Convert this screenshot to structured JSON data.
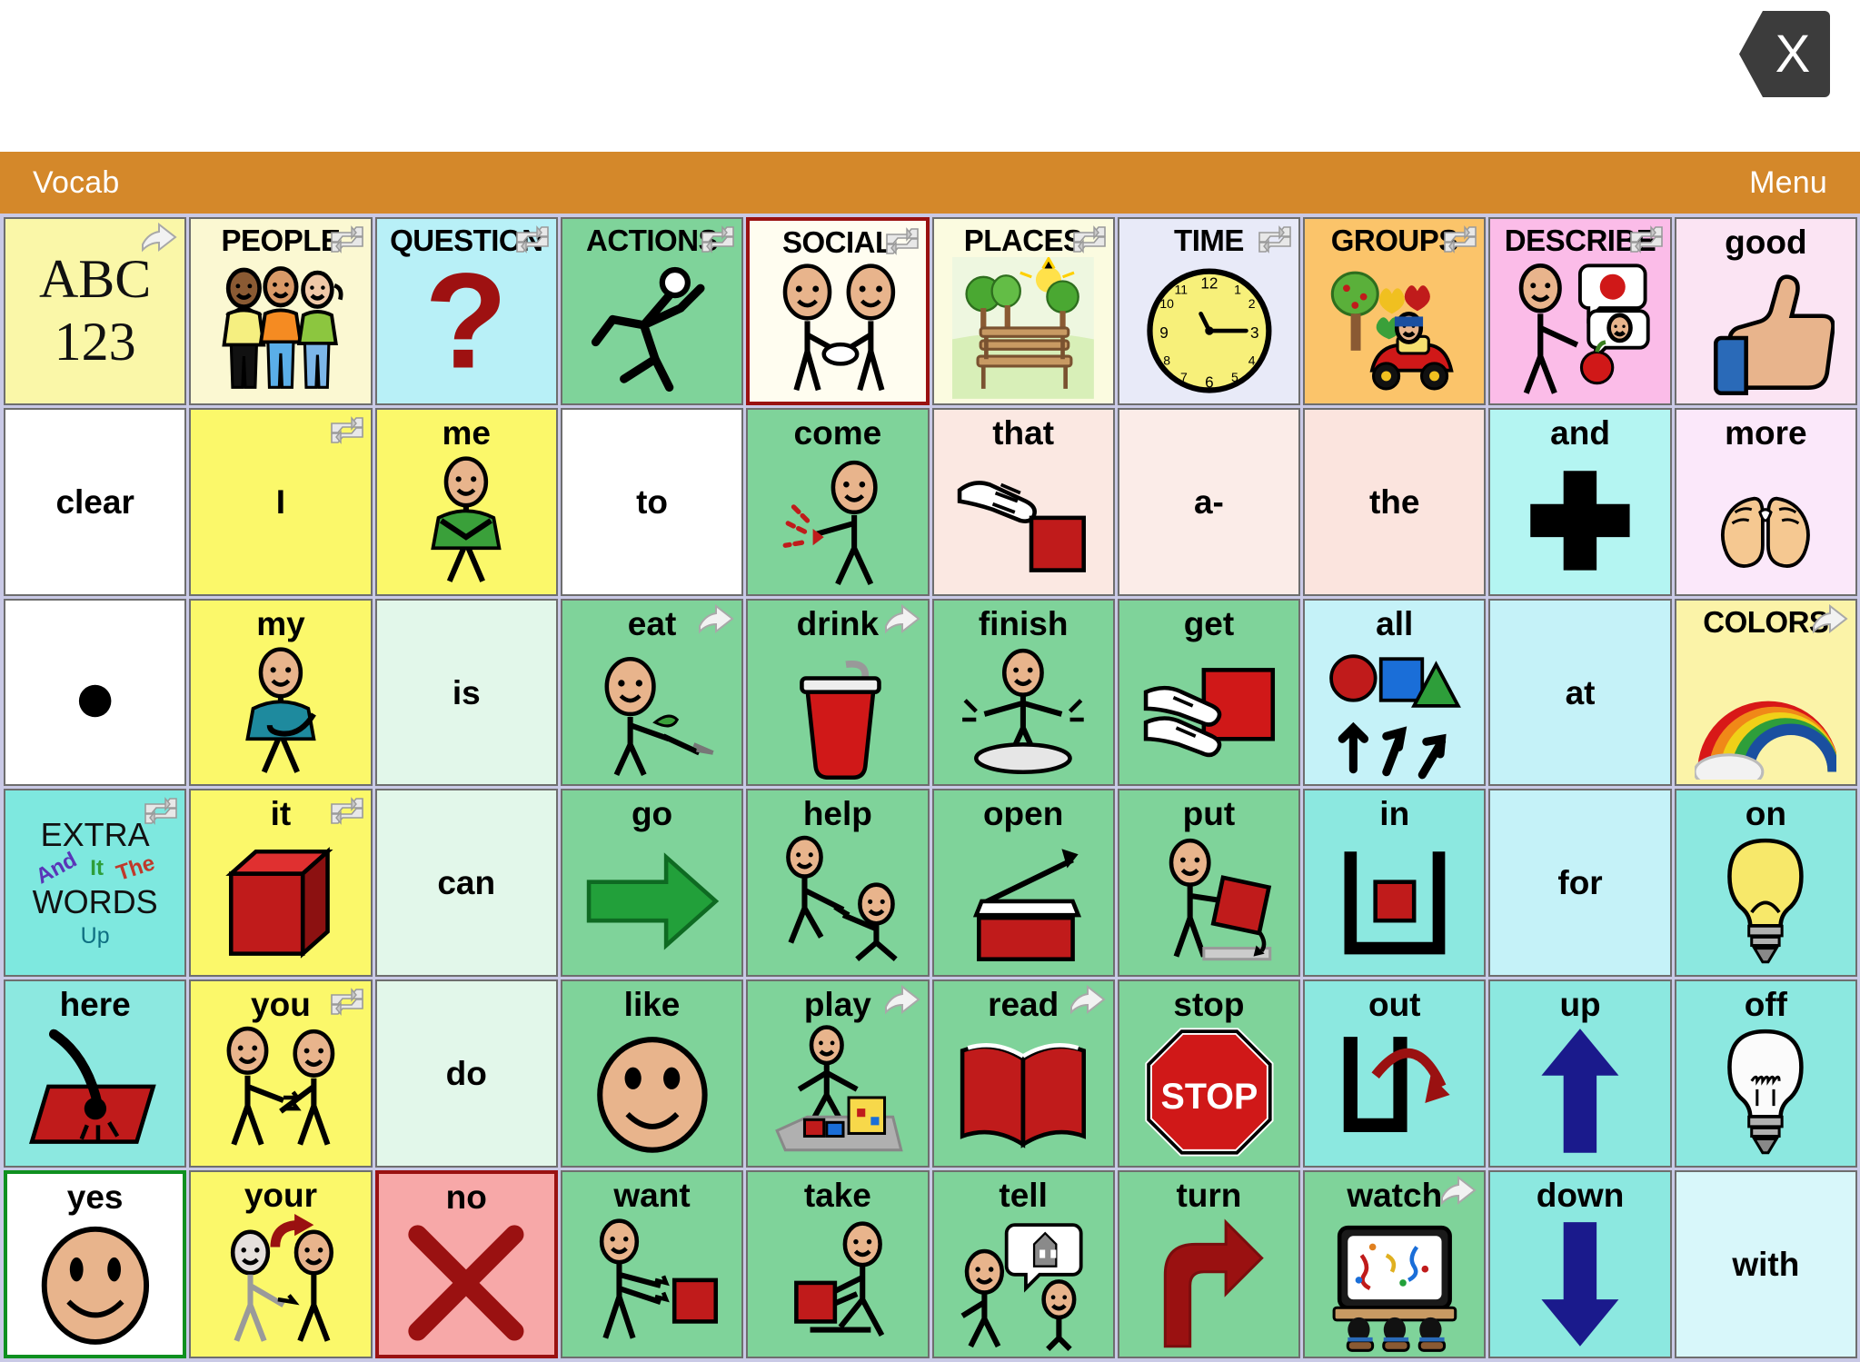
{
  "window": {
    "close_label": "X",
    "close_icon": "close-hexagon-icon"
  },
  "menubar": {
    "left_label": "Vocab",
    "right_label": "Menu",
    "background": "#d4882a"
  },
  "board": {
    "columns": 10,
    "rows": 6,
    "grid_background": "#c9c9e6",
    "cells": [
      {
        "label": "ABC",
        "label2": "123",
        "badge": "arrow",
        "bg": "#faf7a8",
        "art": "none",
        "type": "category"
      },
      {
        "label": "PEOPLE",
        "badge": "link",
        "bg": "#fbf8d2",
        "art": "people-three-icon",
        "type": "category"
      },
      {
        "label": "QUESTION",
        "badge": "link",
        "bg": "#b8f0f7",
        "art": "question-mark-icon",
        "type": "category"
      },
      {
        "label": "ACTIONS",
        "badge": "link",
        "bg": "#7fd39a",
        "art": "running-person-icon",
        "type": "category"
      },
      {
        "label": "SOCIAL",
        "badge": "link",
        "bg": "#fffdf0",
        "art": "two-people-handshake-icon",
        "type": "category",
        "border": "red"
      },
      {
        "label": "PLACES",
        "badge": "link",
        "bg": "#fbfbe0",
        "art": "park-bench-icon",
        "type": "category"
      },
      {
        "label": "TIME",
        "badge": "link",
        "bg": "#e8eaf8",
        "art": "clock-icon",
        "type": "category"
      },
      {
        "label": "GROUPS",
        "badge": "link",
        "bg": "#fbc46a",
        "art": "tree-car-toys-icon",
        "type": "category"
      },
      {
        "label": "DESCRIBE",
        "badge": "link",
        "bg": "#fbbce8",
        "art": "describe-person-icon",
        "type": "category"
      },
      {
        "label": "good",
        "badge": "none",
        "bg": "#fbe4f3",
        "art": "thumbs-up-icon",
        "type": "word"
      },
      {
        "label": "clear",
        "badge": "none",
        "bg": "#ffffff",
        "art": "none",
        "type": "word",
        "center": true
      },
      {
        "label": "I",
        "badge": "link",
        "bg": "#fbf86a",
        "art": "none",
        "type": "word",
        "center": true
      },
      {
        "label": "me",
        "badge": "none",
        "bg": "#fbf86a",
        "art": "me-person-icon",
        "type": "word"
      },
      {
        "label": "to",
        "badge": "none",
        "bg": "#ffffff",
        "art": "none",
        "type": "word",
        "center": true
      },
      {
        "label": "come",
        "badge": "none",
        "bg": "#7fd39a",
        "art": "come-person-icon",
        "type": "word"
      },
      {
        "label": "that",
        "badge": "none",
        "bg": "#fbe8e2",
        "art": "pointing-hand-square-icon",
        "type": "word"
      },
      {
        "label": "a-",
        "badge": "none",
        "bg": "#fbece8",
        "art": "none",
        "type": "word",
        "center": true
      },
      {
        "label": "the",
        "badge": "none",
        "bg": "#fbe4de",
        "art": "none",
        "type": "word",
        "center": true
      },
      {
        "label": "and",
        "badge": "none",
        "bg": "#b4f5f2",
        "art": "plus-sign-icon",
        "type": "word"
      },
      {
        "label": "more",
        "badge": "none",
        "bg": "#fbe8fa",
        "art": "more-hands-icon",
        "type": "word"
      },
      {
        "label": ".",
        "badge": "none",
        "bg": "#ffffff",
        "art": "period-dot-icon",
        "type": "word",
        "dotonly": true
      },
      {
        "label": "my",
        "badge": "none",
        "bg": "#fbf86a",
        "art": "my-person-icon",
        "type": "word"
      },
      {
        "label": "is",
        "badge": "none",
        "bg": "#e2f7ea",
        "art": "none",
        "type": "word",
        "center": true
      },
      {
        "label": "eat",
        "badge": "arrow",
        "bg": "#7fd39a",
        "art": "eating-person-icon",
        "type": "word"
      },
      {
        "label": "drink",
        "badge": "arrow",
        "bg": "#7fd39a",
        "art": "drink-cup-icon",
        "type": "word"
      },
      {
        "label": "finish",
        "badge": "none",
        "bg": "#7fd39a",
        "art": "finish-plate-icon",
        "type": "word"
      },
      {
        "label": "get",
        "badge": "none",
        "bg": "#7fd39a",
        "art": "get-hands-block-icon",
        "type": "word"
      },
      {
        "label": "all",
        "badge": "none",
        "bg": "#c5f2f8",
        "art": "all-shapes-arrows-icon",
        "type": "word"
      },
      {
        "label": "at",
        "badge": "none",
        "bg": "#c5f2f8",
        "art": "none",
        "type": "word",
        "center": true
      },
      {
        "label": "COLORS",
        "badge": "arrow",
        "bg": "#fbf3a8",
        "art": "rainbow-icon",
        "type": "category"
      },
      {
        "label": "EXTRA",
        "label2": "WORDS",
        "badge": "link",
        "bg": "#7ee8df",
        "art": "extra-words-icon",
        "type": "category",
        "extra_words": [
          "And",
          "It",
          "The",
          "Up"
        ]
      },
      {
        "label": "it",
        "badge": "link",
        "bg": "#fbf86a",
        "art": "red-cube-icon",
        "type": "word"
      },
      {
        "label": "can",
        "badge": "none",
        "bg": "#e2f7ea",
        "art": "none",
        "type": "word",
        "center": true
      },
      {
        "label": "go",
        "badge": "none",
        "bg": "#7fd39a",
        "art": "green-arrow-right-icon",
        "type": "word"
      },
      {
        "label": "help",
        "badge": "none",
        "bg": "#7fd39a",
        "art": "help-people-icon",
        "type": "word"
      },
      {
        "label": "open",
        "badge": "none",
        "bg": "#7fd39a",
        "art": "open-box-icon",
        "type": "word"
      },
      {
        "label": "put",
        "badge": "none",
        "bg": "#7fd39a",
        "art": "put-person-icon",
        "type": "word"
      },
      {
        "label": "in",
        "badge": "none",
        "bg": "#8ce8e0",
        "art": "in-container-icon",
        "type": "word"
      },
      {
        "label": "for",
        "badge": "none",
        "bg": "#c5f2f8",
        "art": "none",
        "type": "word",
        "center": true
      },
      {
        "label": "on",
        "badge": "none",
        "bg": "#8ce8e0",
        "art": "lightbulb-on-icon",
        "type": "word"
      },
      {
        "label": "here",
        "badge": "none",
        "bg": "#8ce8e0",
        "art": "here-pointing-icon",
        "type": "word"
      },
      {
        "label": "you",
        "badge": "link",
        "bg": "#fbf86a",
        "art": "you-two-people-icon",
        "type": "word"
      },
      {
        "label": "do",
        "badge": "none",
        "bg": "#e2f7ea",
        "art": "none",
        "type": "word",
        "center": true
      },
      {
        "label": "like",
        "badge": "none",
        "bg": "#7fd39a",
        "art": "like-smiley-icon",
        "type": "word"
      },
      {
        "label": "play",
        "badge": "arrow",
        "bg": "#7fd39a",
        "art": "play-child-toys-icon",
        "type": "word"
      },
      {
        "label": "read",
        "badge": "arrow",
        "bg": "#7fd39a",
        "art": "open-book-icon",
        "type": "word"
      },
      {
        "label": "stop",
        "badge": "none",
        "bg": "#7fd39a",
        "art": "stop-sign-icon",
        "type": "word"
      },
      {
        "label": "out",
        "badge": "none",
        "bg": "#8ce8e0",
        "art": "out-arrow-icon",
        "type": "word"
      },
      {
        "label": "up",
        "badge": "none",
        "bg": "#8ce8e0",
        "art": "up-arrow-icon",
        "type": "word"
      },
      {
        "label": "off",
        "badge": "none",
        "bg": "#8ce8e0",
        "art": "lightbulb-off-icon",
        "type": "word"
      },
      {
        "label": "yes",
        "badge": "none",
        "bg": "#ffffff",
        "art": "smiley-face-icon",
        "type": "word",
        "border": "green"
      },
      {
        "label": "your",
        "badge": "none",
        "bg": "#fbf86a",
        "art": "your-two-people-icon",
        "type": "word"
      },
      {
        "label": "no",
        "badge": "none",
        "bg": "#f7a8a8",
        "art": "red-x-icon",
        "type": "word",
        "border": "red"
      },
      {
        "label": "want",
        "badge": "none",
        "bg": "#7fd39a",
        "art": "want-person-block-icon",
        "type": "word"
      },
      {
        "label": "take",
        "badge": "none",
        "bg": "#7fd39a",
        "art": "take-person-block-icon",
        "type": "word"
      },
      {
        "label": "tell",
        "badge": "none",
        "bg": "#7fd39a",
        "art": "tell-speech-icon",
        "type": "word"
      },
      {
        "label": "turn",
        "badge": "none",
        "bg": "#7fd39a",
        "art": "turn-arrow-icon",
        "type": "word"
      },
      {
        "label": "watch",
        "badge": "arrow",
        "bg": "#7fd39a",
        "art": "watch-tv-icon",
        "type": "word"
      },
      {
        "label": "down",
        "badge": "none",
        "bg": "#8ce8e0",
        "art": "down-arrow-icon",
        "type": "word"
      },
      {
        "label": "with",
        "badge": "none",
        "bg": "#d8f7fa",
        "art": "none",
        "type": "word",
        "center": true
      }
    ]
  }
}
